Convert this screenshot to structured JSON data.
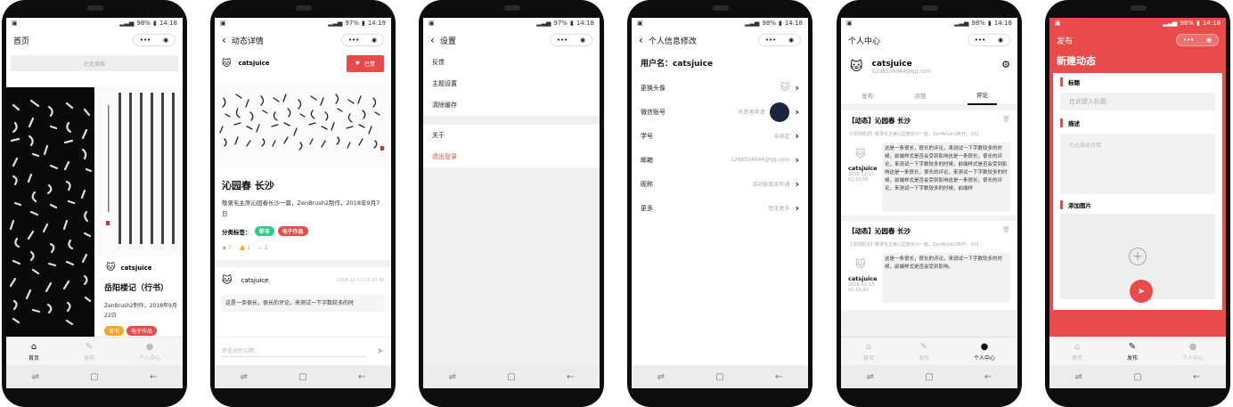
{
  "status": {
    "p1": {
      "battery": "98%",
      "time": "14:18"
    },
    "p2": {
      "battery": "97%",
      "time": "14:19"
    },
    "p3": {
      "battery": "97%",
      "time": "14:18"
    },
    "p4": {
      "battery": "98%",
      "time": "14:18"
    },
    "p5": {
      "battery": "98%",
      "time": "14:18"
    },
    "p6": {
      "battery": "98%",
      "time": "14:18"
    }
  },
  "capsule": {
    "dots": "•••"
  },
  "home": {
    "title": "首页",
    "search_placeholder": "在此搜索",
    "author": "catsjuice",
    "work_title": "岳阳楼记（行书）",
    "desc": "ZenBrush2制作，2018年9月22日",
    "tags": [
      "草书",
      "电子作品"
    ]
  },
  "tabs": {
    "home": "首页",
    "publish": "发布",
    "me": "个人中心"
  },
  "detail": {
    "title": "动态详情",
    "author": "catsjuice",
    "liked": "已赞",
    "work_title": "沁园春 长沙",
    "desc": "敬录毛主席沁园春长沙一篇，ZenBrush2制作，2018年9月7日",
    "tag_label": "分类标签：",
    "tags": [
      "草书",
      "电子作品"
    ],
    "views": "7",
    "likes": "1",
    "comments": "2",
    "comment_user": "catsjuice",
    "comment_time": "2018-12-13 02:10:56",
    "comment_text": "这是一条很长，很长的评论，来测试一下字数较多的时",
    "input_placeholder": "评论点什么吧..."
  },
  "settings": {
    "title": "设置",
    "items": [
      "反馈",
      "主题设置",
      "清除缓存"
    ],
    "about": "关于",
    "logout": "退出登录"
  },
  "profile_edit": {
    "title": "个人信息修改",
    "username_label": "用户名：catsjuice",
    "rows": [
      {
        "label": "更换头像",
        "value": ""
      },
      {
        "label": "微信账号",
        "value": "有意者申请"
      },
      {
        "label": "学号",
        "value": "未绑定"
      },
      {
        "label": "邮箱",
        "value": "1298554944@qq.com"
      },
      {
        "label": "昵称",
        "value": "该功能暂未开通"
      },
      {
        "label": "更多",
        "value": "暂无更多"
      }
    ]
  },
  "me": {
    "title": "个人中心",
    "name": "catsjuice",
    "email": "1298554944@qq.com",
    "tabs": [
      "发布",
      "点赞",
      "评论"
    ],
    "cards": [
      {
        "title": "【动态】沁园春 长沙",
        "summary": "【详情概述】敬录毛主席沁园春长沙一篇，ZenBrush2制作，201...",
        "user": "catsjuice",
        "date": "2018-12-13",
        "time": "02:10:56",
        "text": "这是一条很长，很长的评论，来测试一下字数较多的时候，前端样式是否会受到影响这是一条很长，很长的评论，来测试一下字数较多的时候，前端样式是否会受到影响这是一条很长，很长的评论，来测试一下字数较多的时候，前端样式是否会受到影响这是一条很长，很长的评论，来测试一下字数较多的时候，前端样"
      },
      {
        "title": "【动态】沁园春 长沙",
        "summary": "【详情概述】敬录毛主席沁园春长沙一篇，ZenBrush2制作，201...",
        "user": "catsjuice",
        "date": "2018-12-13",
        "time": "02:10:20",
        "text": "这是一条很长，很长的评论，来测试一下字数较多的时候，前端样式是否会受到影响。"
      }
    ]
  },
  "publish": {
    "nav_title": "发布",
    "heading": "新建动态",
    "title_label": "标题",
    "title_placeholder": "在此键入标题",
    "desc_label": "描述",
    "desc_placeholder": "在此描述详情",
    "image_label": "添加图片"
  },
  "colors": {
    "accent": "#e94b4b",
    "tag_green": "#2ecc8a",
    "tag_orange": "#f5a623",
    "tag_red": "#e94b4b"
  }
}
